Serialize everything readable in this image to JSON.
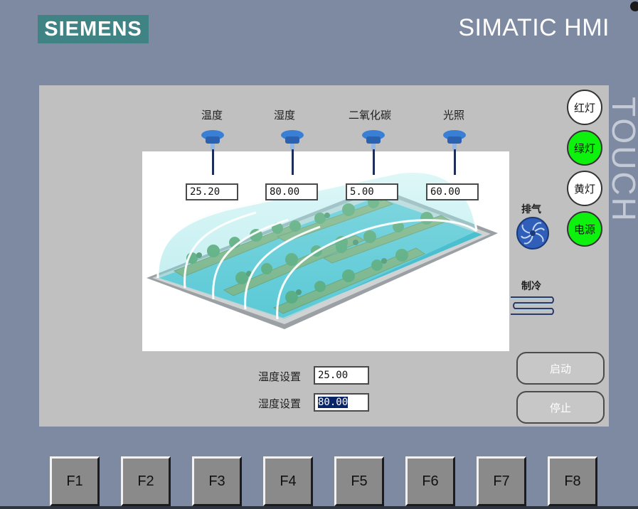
{
  "header": {
    "brand": "SIEMENS",
    "product": "SIMATIC HMI",
    "side_text": "TOUCH"
  },
  "sensors": [
    {
      "label": "温度",
      "value": "25.20"
    },
    {
      "label": "湿度",
      "value": "80.00"
    },
    {
      "label": "二氧化碳",
      "value": "5.00"
    },
    {
      "label": "光照",
      "value": "60.00"
    }
  ],
  "lamps": [
    {
      "label": "红灯",
      "state": "off"
    },
    {
      "label": "绿灯",
      "state": "on"
    },
    {
      "label": "黄灯",
      "state": "off"
    },
    {
      "label": "电源",
      "state": "on"
    }
  ],
  "devices": {
    "exhaust_label": "排气",
    "cooling_label": "制冷"
  },
  "buttons": {
    "start": "启动",
    "stop": "停止"
  },
  "setpoints": [
    {
      "label": "温度设置",
      "value": "25.00"
    },
    {
      "label": "湿度设置",
      "value": "80.00"
    }
  ],
  "function_keys": [
    "F1",
    "F2",
    "F3",
    "F4",
    "F5",
    "F6",
    "F7",
    "F8"
  ],
  "colors": {
    "panel": "#7e8aa1",
    "screen": "#c0c0c0",
    "brand": "#3f8384",
    "lamp_on": "#0ef00e",
    "selection": "#0a246a"
  }
}
